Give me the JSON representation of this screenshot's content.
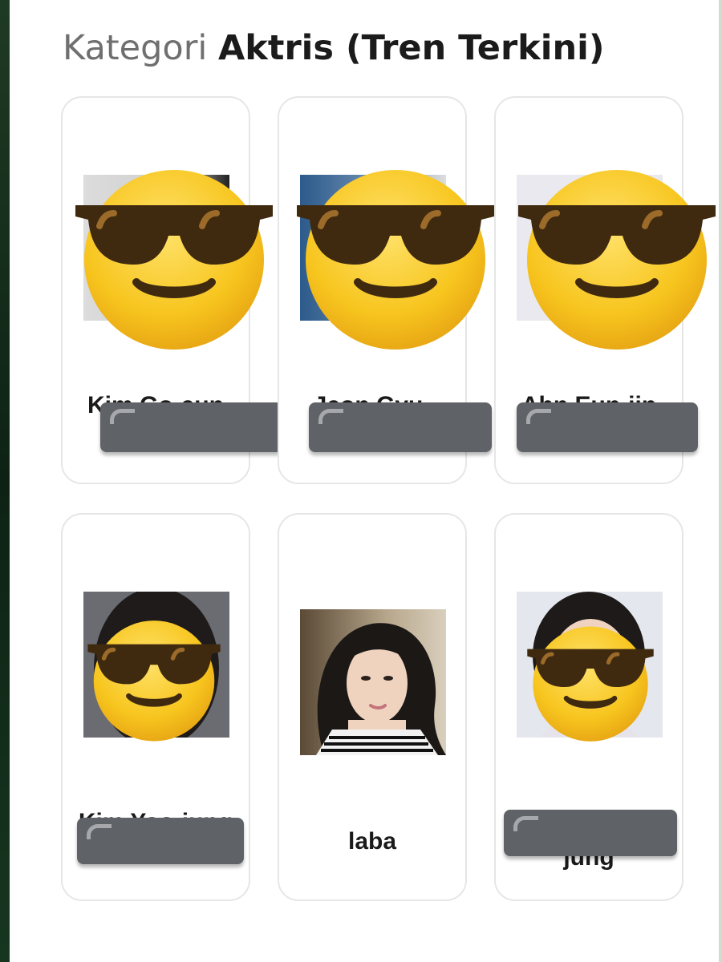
{
  "heading": {
    "prefix": "Kategori",
    "title": "Aktris (Tren Terkini)"
  },
  "cards": [
    {
      "name_visible": "Kim Go-eun",
      "redacted": true
    },
    {
      "name_visible": "Jeon Gyu-young",
      "redacted": true
    },
    {
      "name_visible": "Ahn Eun-jin",
      "redacted": true
    },
    {
      "name_visible": "Kim Yoo-jung",
      "redacted": true
    },
    {
      "name_visible": "laba",
      "redacted": false
    },
    {
      "name_visible": "jung",
      "redacted": true
    }
  ],
  "overlay_icon": "sunglasses-face-emoji",
  "colors": {
    "heading_prefix": "#6f6f6f",
    "heading_title": "#1b1b1b",
    "card_border": "#e6e6e6",
    "redaction_bar": "#5f6266",
    "emoji_face": "#f7c51e",
    "emoji_glasses": "#3f2a10"
  }
}
